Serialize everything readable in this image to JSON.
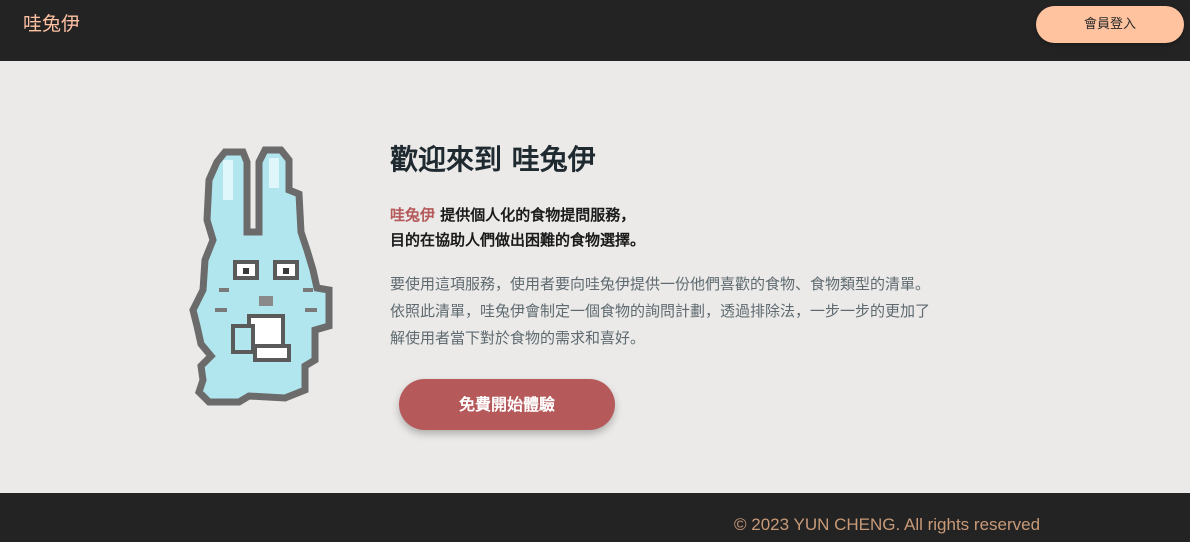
{
  "header": {
    "brand": "哇兔伊",
    "login_label": "會員登入"
  },
  "hero": {
    "title": "歡迎來到 哇兔伊",
    "intro_highlight": "哇兔伊",
    "intro_line1_rest": " 提供個人化的食物提問服務，",
    "intro_line2": "目的在協助人們做出困難的食物選擇。",
    "desc_lines": [
      "要使用這項服務，使用者要向哇兔伊提供一份他們喜歡的食物、食物類型的清單。",
      "依照此清單，哇兔伊會制定一個食物的詢問計劃，透過排除法，一步一步的更加了",
      "解使用者當下對於食物的需求和喜好。"
    ],
    "cta_label": "免費開始體驗",
    "mascot_icon": "pixel-rabbit-icon"
  },
  "footer": {
    "copyright": "© 2023 YUN CHENG. All rights reserved"
  },
  "colors": {
    "header_bg": "#232323",
    "brand": "#ffc2a3",
    "login_bg": "#ffc39f",
    "accent": "#b5595a",
    "page_bg": "#ebeae8",
    "mascot_fill": "#b2e6ef"
  }
}
